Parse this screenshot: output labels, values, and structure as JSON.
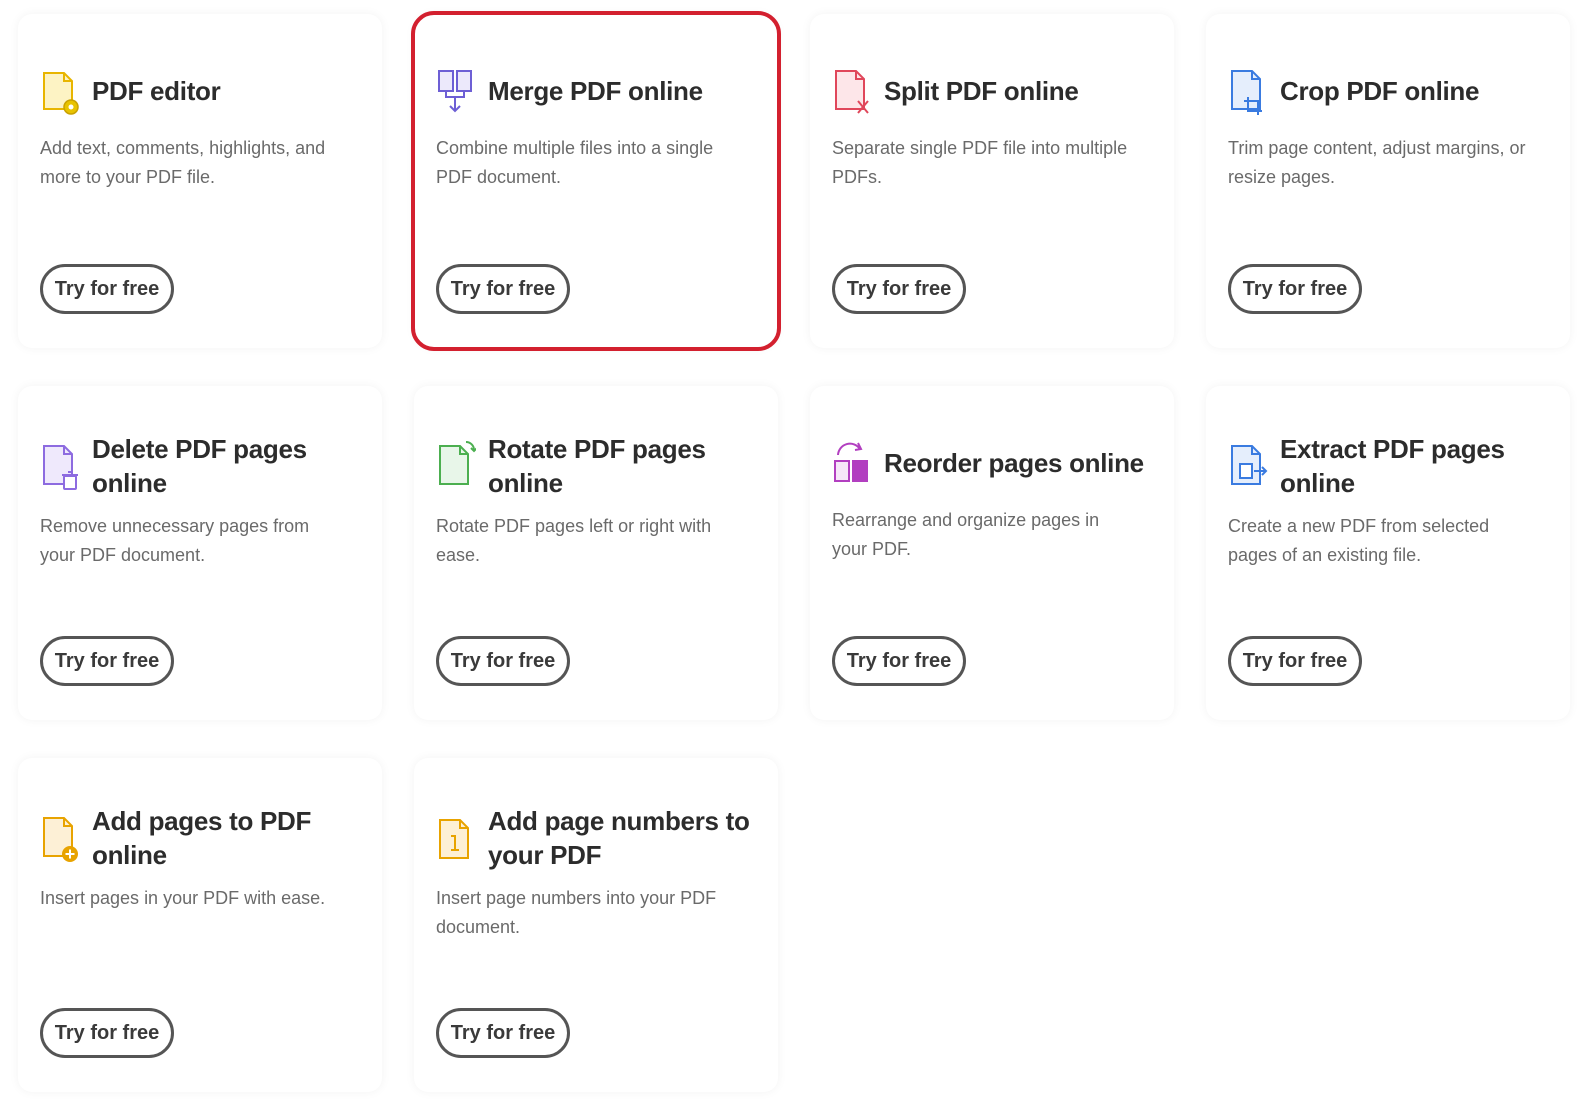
{
  "cards": [
    {
      "title": "PDF editor",
      "description": "Add text, comments, highlights, and more to your PDF file.",
      "button_label": "Try for free",
      "icon": "edit-pdf-icon",
      "accent": "#e8b500"
    },
    {
      "title": "Merge PDF online",
      "description": "Combine multiple files into a single PDF document.",
      "button_label": "Try for free",
      "icon": "merge-pdf-icon",
      "accent": "#6d5fd5",
      "highlighted": true
    },
    {
      "title": "Split PDF online",
      "description": "Separate single PDF file into multiple PDFs.",
      "button_label": "Try for free",
      "icon": "split-pdf-icon",
      "accent": "#e0475b"
    },
    {
      "title": "Crop PDF online",
      "description": "Trim page content, adjust margins, or resize pages.",
      "button_label": "Try for free",
      "icon": "crop-pdf-icon",
      "accent": "#3a7be0"
    },
    {
      "title": "Delete PDF pages online",
      "description": "Remove unnecessary pages from your PDF document.",
      "button_label": "Try for free",
      "icon": "delete-pages-icon",
      "accent": "#8d6be0"
    },
    {
      "title": "Rotate PDF pages online",
      "description": "Rotate PDF pages left or right with ease.",
      "button_label": "Try for free",
      "icon": "rotate-pages-icon",
      "accent": "#4caf50"
    },
    {
      "title": "Reorder pages online",
      "description": "Rearrange and organize pages in your PDF.",
      "button_label": "Try for free",
      "icon": "reorder-pages-icon",
      "accent": "#b23fc0"
    },
    {
      "title": "Extract PDF pages online",
      "description": "Create a new PDF from selected pages of an existing file.",
      "button_label": "Try for free",
      "icon": "extract-pages-icon",
      "accent": "#3a7be0"
    },
    {
      "title": "Add pages to PDF online",
      "description": "Insert pages in your PDF with ease.",
      "button_label": "Try for free",
      "icon": "add-pages-icon",
      "accent": "#e8a300"
    },
    {
      "title": "Add page numbers to your PDF",
      "description": "Insert page numbers into your PDF document.",
      "button_label": "Try for free",
      "icon": "page-numbers-icon",
      "accent": "#e8a300"
    }
  ]
}
